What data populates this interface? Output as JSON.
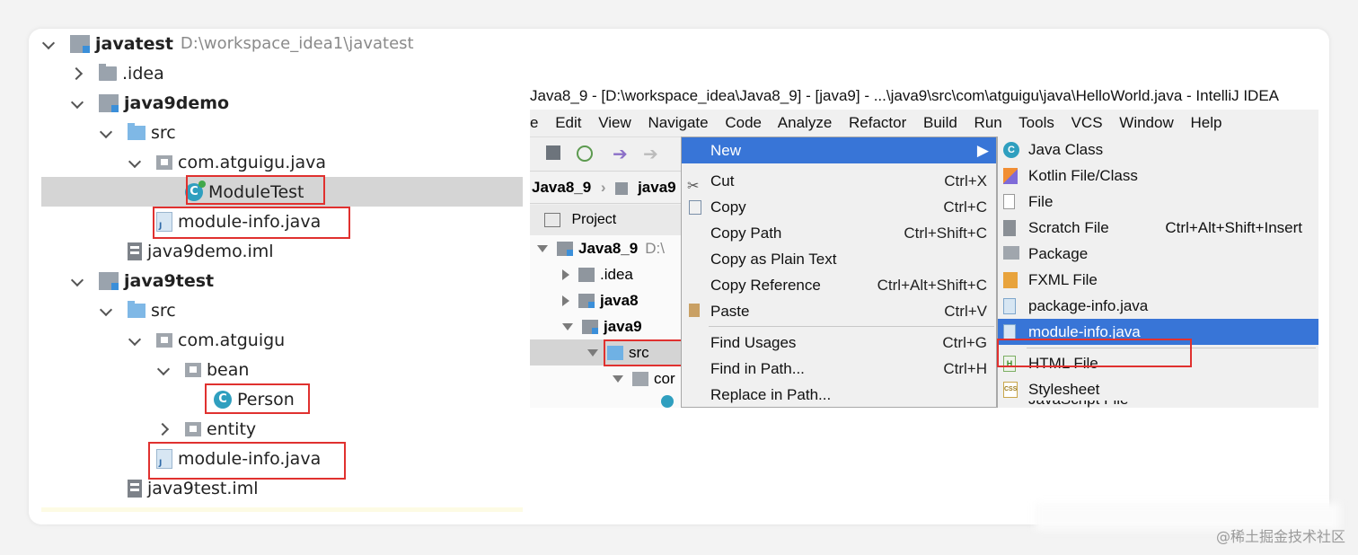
{
  "project_tree": {
    "root": {
      "name": "javatest",
      "path": "D:\\workspace_idea1\\javatest"
    },
    "rows": [
      {
        "label": ".idea"
      },
      {
        "label": "java9demo"
      },
      {
        "label": "src"
      },
      {
        "label": "com.atguigu.java"
      },
      {
        "label": "ModuleTest"
      },
      {
        "label": "module-info.java"
      },
      {
        "label": "java9demo.iml"
      },
      {
        "label": "java9test"
      },
      {
        "label": "src"
      },
      {
        "label": "com.atguigu"
      },
      {
        "label": "bean"
      },
      {
        "label": "Person"
      },
      {
        "label": "entity"
      },
      {
        "label": "module-info.java"
      },
      {
        "label": "java9test.iml"
      }
    ]
  },
  "ide": {
    "title": "Java8_9 - [D:\\workspace_idea\\Java8_9] - [java9] - ...\\java9\\src\\com\\atguigu\\java\\HelloWorld.java - IntelliJ IDEA",
    "menu": [
      "e",
      "Edit",
      "View",
      "Navigate",
      "Code",
      "Analyze",
      "Refactor",
      "Build",
      "Run",
      "Tools",
      "VCS",
      "Window",
      "Help"
    ],
    "breadcrumbs": [
      "Java8_9",
      "java9"
    ],
    "project_tab": "Project",
    "tree": [
      {
        "label": "Java8_9",
        "path": "D:\\"
      },
      {
        "label": ".idea"
      },
      {
        "label": "java8"
      },
      {
        "label": "java9"
      },
      {
        "label": "src"
      },
      {
        "label": "cor"
      }
    ],
    "context_menu": [
      {
        "label": "New",
        "shortcut": ""
      },
      {
        "label": "Cut",
        "shortcut": "Ctrl+X"
      },
      {
        "label": "Copy",
        "shortcut": "Ctrl+C"
      },
      {
        "label": "Copy Path",
        "shortcut": "Ctrl+Shift+C"
      },
      {
        "label": "Copy as Plain Text",
        "shortcut": ""
      },
      {
        "label": "Copy Reference",
        "shortcut": "Ctrl+Alt+Shift+C"
      },
      {
        "label": "Paste",
        "shortcut": "Ctrl+V"
      },
      {
        "label": "Find Usages",
        "shortcut": "Ctrl+G"
      },
      {
        "label": "Find in Path...",
        "shortcut": "Ctrl+H"
      },
      {
        "label": "Replace in Path...",
        "shortcut": ""
      }
    ],
    "submenu": [
      {
        "label": "Java Class",
        "shortcut": ""
      },
      {
        "label": "Kotlin File/Class",
        "shortcut": ""
      },
      {
        "label": "File",
        "shortcut": ""
      },
      {
        "label": "Scratch File",
        "shortcut": "Ctrl+Alt+Shift+Insert"
      },
      {
        "label": "Package",
        "shortcut": ""
      },
      {
        "label": "FXML File",
        "shortcut": ""
      },
      {
        "label": "package-info.java",
        "shortcut": ""
      },
      {
        "label": "module-info.java",
        "shortcut": ""
      },
      {
        "label": "HTML File",
        "shortcut": ""
      },
      {
        "label": "Stylesheet",
        "shortcut": ""
      },
      {
        "label": "JavaScript File",
        "shortcut": ""
      }
    ]
  },
  "watermark": "@稀土掘金技术社区",
  "colors": {
    "highlight_box": "#e0312f",
    "menu_selection": "#3875d7",
    "selected_row": "#d5d5d5"
  }
}
